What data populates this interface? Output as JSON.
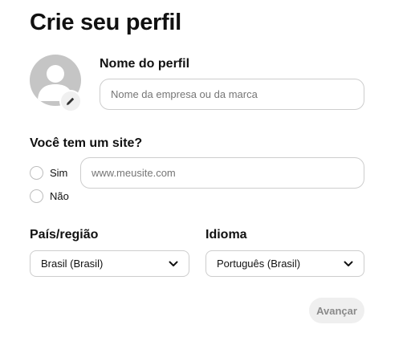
{
  "header": {
    "title": "Crie seu perfil"
  },
  "profile": {
    "avatar_icon": "user-silhouette-icon",
    "edit_icon": "pencil-icon",
    "name_label": "Nome do perfil",
    "name_value": "",
    "name_placeholder": "Nome da empresa ou da marca"
  },
  "website": {
    "question": "Você tem um site?",
    "options": [
      {
        "label": "Sim",
        "selected": false
      },
      {
        "label": "Não",
        "selected": false
      }
    ],
    "url_value": "",
    "url_placeholder": "www.meusite.com"
  },
  "country": {
    "label": "País/região",
    "selected": "Brasil (Brasil)",
    "icon": "chevron-down-icon"
  },
  "language": {
    "label": "Idioma",
    "selected": "Português (Brasil)",
    "icon": "chevron-down-icon"
  },
  "actions": {
    "next_label": "Avançar"
  },
  "colors": {
    "text": "#111111",
    "border": "#cdcdcd",
    "avatar_bg": "#c5c5c5",
    "button_bg": "#efefef",
    "button_text": "#8a8a8a"
  }
}
